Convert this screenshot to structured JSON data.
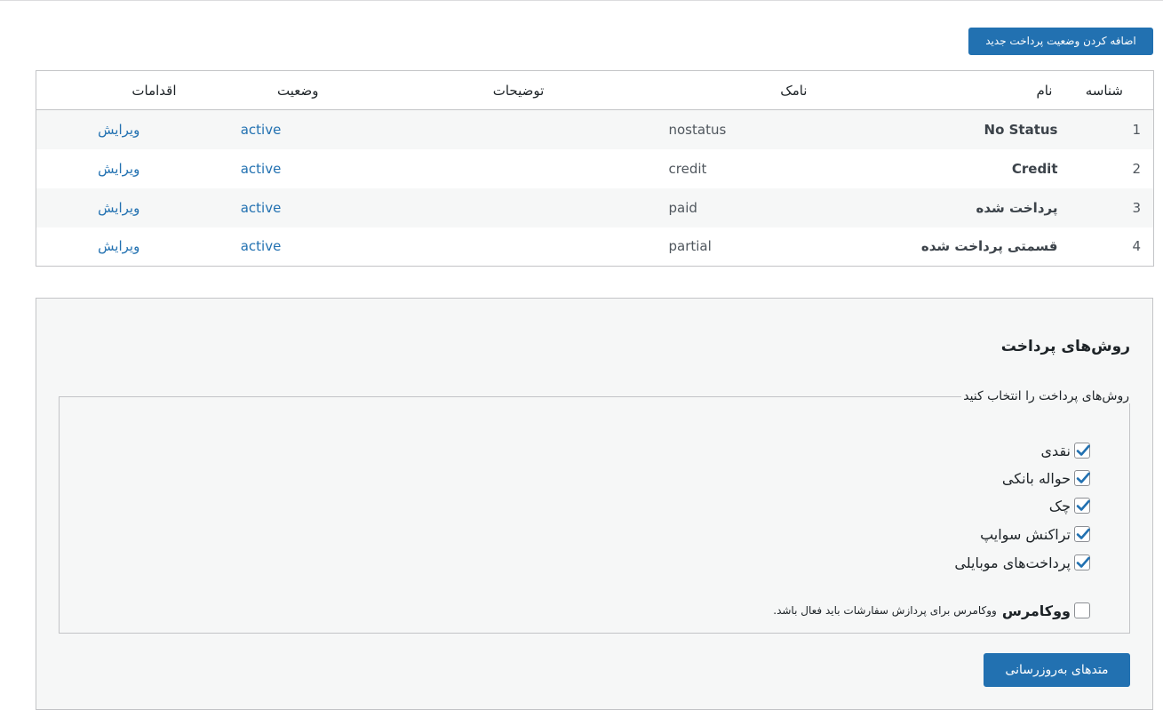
{
  "add_button_label": "اضافه کردن وضعیت پرداخت جدید",
  "table": {
    "headers": {
      "id": "شناسه",
      "name": "نام",
      "slug": "نامک",
      "description": "توضیحات",
      "status": "وضعیت",
      "actions": "اقدامات"
    },
    "rows": [
      {
        "id": "1",
        "name": "No Status",
        "slug": "nostatus",
        "description": "",
        "status": "active",
        "action": "ویرایش"
      },
      {
        "id": "2",
        "name": "Credit",
        "slug": "credit",
        "description": "",
        "status": "active",
        "action": "ویرایش"
      },
      {
        "id": "3",
        "name": "پرداخت شده",
        "slug": "paid",
        "description": "",
        "status": "active",
        "action": "ویرایش"
      },
      {
        "id": "4",
        "name": "قسمتی پرداخت شده",
        "slug": "partial",
        "description": "",
        "status": "active",
        "action": "ویرایش"
      }
    ]
  },
  "payment_methods": {
    "title": "روش‌های پرداخت",
    "legend": "روش‌های پرداخت را انتخاب کنید",
    "methods": [
      {
        "label": "نقدی",
        "checked": true
      },
      {
        "label": "حواله بانکی",
        "checked": true
      },
      {
        "label": "چک",
        "checked": true
      },
      {
        "label": "تراکنش سوایپ",
        "checked": true
      },
      {
        "label": "پرداخت‌های موبایلی",
        "checked": true
      }
    ],
    "woocommerce": {
      "label": "ووکامرس",
      "note": "ووکامرس برای پردازش سفارشات باید فعال باشد.",
      "checked": false
    },
    "update_button_label": "متدهای به‌روزرسانی"
  },
  "colors": {
    "accent": "#2271b1",
    "border": "#c3c4c7",
    "panel_bg": "#f6f7f7"
  }
}
